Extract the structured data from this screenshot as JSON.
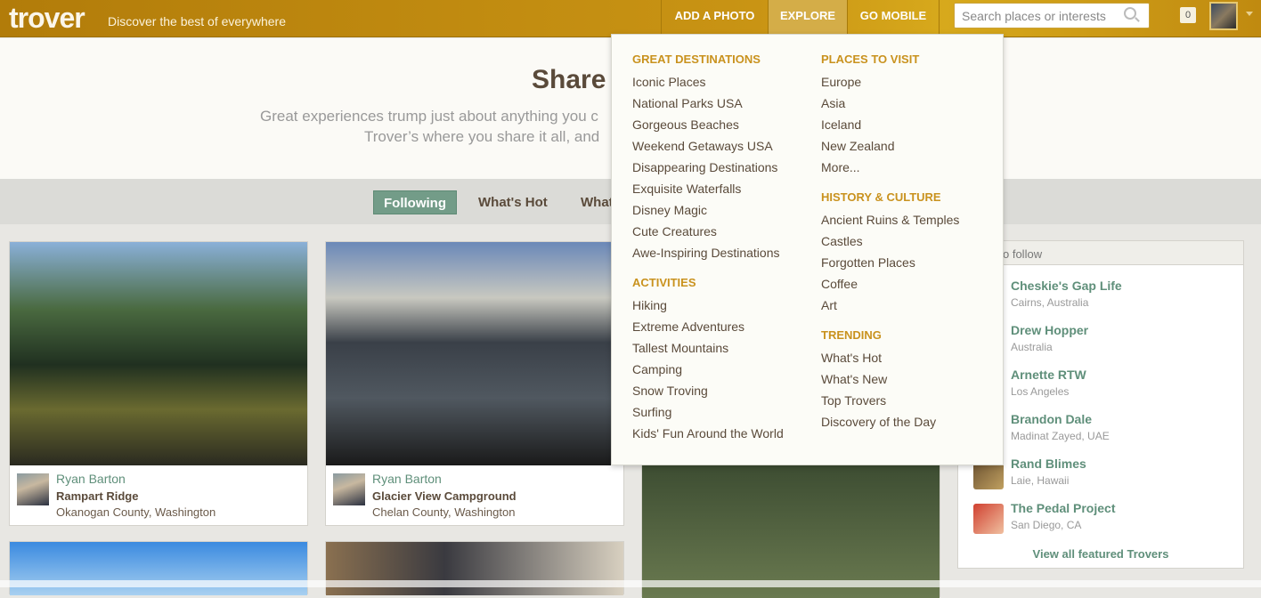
{
  "header": {
    "logo": "trover",
    "tagline": "Discover the best of everywhere",
    "nav": [
      "ADD A PHOTO",
      "EXPLORE",
      "GO MOBILE"
    ],
    "active_nav": "EXPLORE",
    "search_placeholder": "Search places or interests",
    "notifications": "0"
  },
  "hero": {
    "title": "Share",
    "subtitle_line1": "Great experiences trump just about anything you c",
    "subtitle_line2": "Trover’s where you share it all, and"
  },
  "tabs": [
    "Following",
    "What's Hot",
    "What"
  ],
  "active_tab": "Following",
  "cards": [
    {
      "user": "Ryan Barton",
      "title": "Rampart Ridge",
      "location": "Okanogan County, Washington"
    },
    {
      "user": "Ryan Barton",
      "title": "Glacier View Campground",
      "location": "Chelan County, Washington"
    }
  ],
  "sidebar": {
    "heading": "o follow",
    "items": [
      {
        "name": "Cheskie's Gap Life",
        "location": "Cairns, Australia"
      },
      {
        "name": "Drew Hopper",
        "location": "Australia"
      },
      {
        "name": "Arnette RTW",
        "location": "Los Angeles"
      },
      {
        "name": "Brandon Dale",
        "location": "Madinat Zayed, UAE"
      },
      {
        "name": "Rand Blimes",
        "location": "Laie, Hawaii"
      },
      {
        "name": "The Pedal Project",
        "location": "San Diego, CA"
      }
    ],
    "view_all": "View all featured Trovers"
  },
  "explore_menu": {
    "left": [
      {
        "heading": "GREAT DESTINATIONS",
        "items": [
          "Iconic Places",
          "National Parks USA",
          "Gorgeous Beaches",
          "Weekend Getaways USA",
          "Disappearing Destinations",
          "Exquisite Waterfalls",
          "Disney Magic",
          "Cute Creatures",
          "Awe-Inspiring Destinations"
        ]
      },
      {
        "heading": "ACTIVITIES",
        "items": [
          "Hiking",
          "Extreme Adventures",
          "Tallest Mountains",
          "Camping",
          "Snow Troving",
          "Surfing",
          "Kids' Fun Around the World"
        ]
      }
    ],
    "right": [
      {
        "heading": "PLACES TO VISIT",
        "items": [
          "Europe",
          "Asia",
          "Iceland",
          "New Zealand",
          "More..."
        ]
      },
      {
        "heading": "HISTORY & CULTURE",
        "items": [
          "Ancient Ruins & Temples",
          "Castles",
          "Forgotten Places",
          "Coffee",
          "Art"
        ]
      },
      {
        "heading": "TRENDING",
        "items": [
          "What's Hot",
          "What's New",
          "Top Trovers",
          "Discovery of the Day"
        ]
      }
    ]
  },
  "colors": {
    "brand_gold": "#c99414",
    "accent_green": "#739c88",
    "link_green": "#5f8f7a",
    "menu_heading": "#c9921e"
  }
}
